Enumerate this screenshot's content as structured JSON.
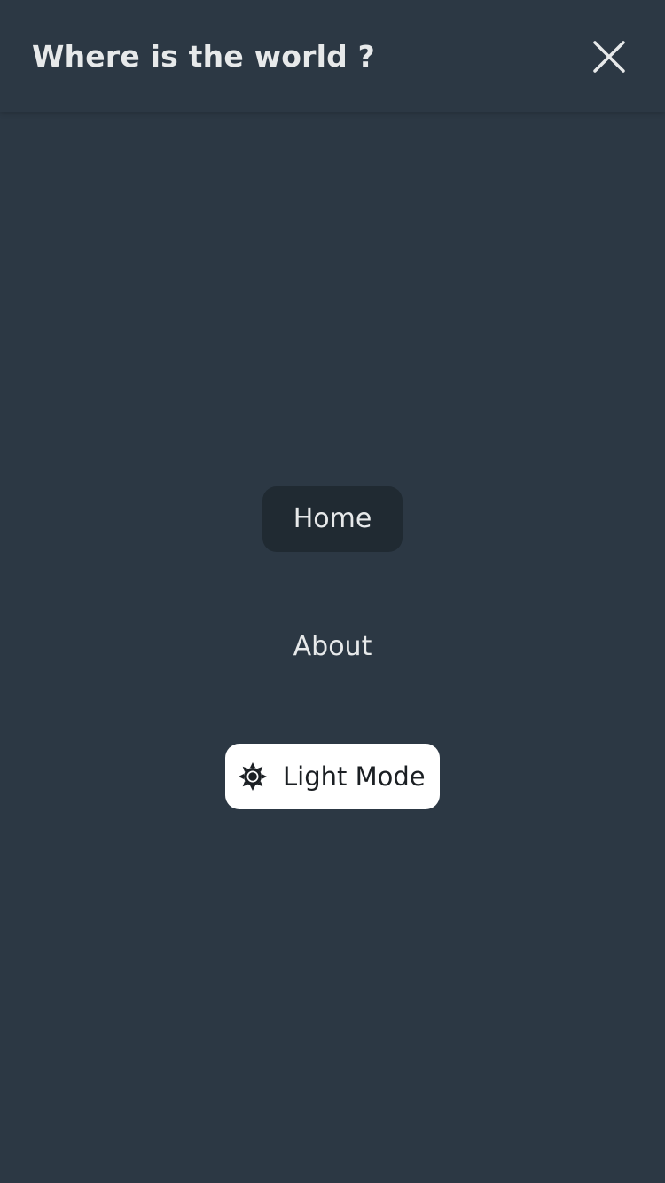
{
  "header": {
    "title": "Where is the world ?",
    "close_icon": "close-icon"
  },
  "nav": {
    "items": [
      {
        "label": "Home",
        "active": true
      },
      {
        "label": "About",
        "active": false
      }
    ]
  },
  "theme_toggle": {
    "icon": "sun-icon",
    "label": "Light Mode"
  },
  "colors": {
    "background": "#2c3844",
    "active_item_background": "#202a32",
    "text": "#e7e9ea",
    "toggle_background": "#ffffff",
    "toggle_text": "#1b1f23"
  }
}
